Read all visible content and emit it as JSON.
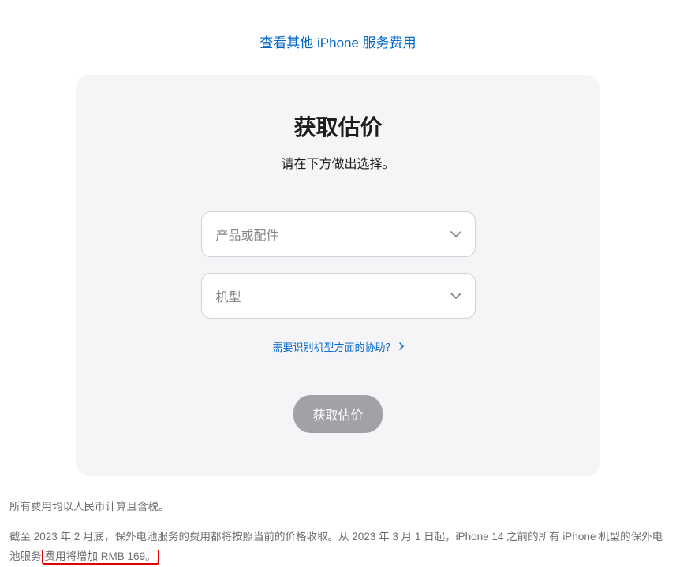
{
  "topLink": {
    "text": "查看其他 iPhone 服务费用"
  },
  "card": {
    "title": "获取估价",
    "subtitle": "请在下方做出选择。",
    "select1": {
      "placeholder": "产品或配件"
    },
    "select2": {
      "placeholder": "机型"
    },
    "helpLink": "需要识别机型方面的协助？",
    "button": "获取估价"
  },
  "footer": {
    "line1": "所有费用均以人民币计算且含税。",
    "line2_a": "截至 2023 年 2 月底，保外电池服务的费用都将按照当前的价格收取。从 2023 年 3 月 1 日起，iPhone 14 之前的所有 iPhone 机型的保外电池服务",
    "line2_b": "费用将增加 RMB 169。"
  }
}
